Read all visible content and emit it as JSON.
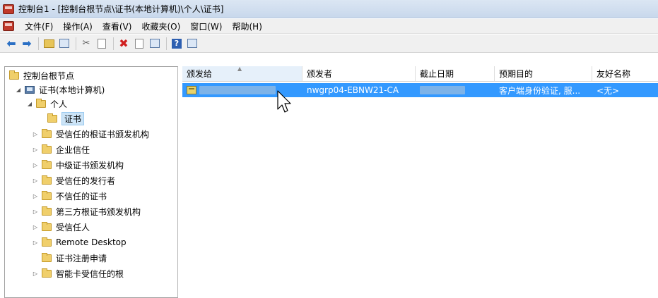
{
  "window": {
    "title": "控制台1 - [控制台根节点\\证书(本地计算机)\\个人\\证书]"
  },
  "menu": [
    "文件(F)",
    "操作(A)",
    "查看(V)",
    "收藏夹(O)",
    "窗口(W)",
    "帮助(H)"
  ],
  "toolbar": {
    "icons": [
      "back-icon",
      "forward-icon",
      "up-folder-icon",
      "show-tree-icon",
      "cut-icon",
      "copy-icon",
      "delete-icon",
      "properties-icon",
      "export-icon",
      "help-icon",
      "console-icon"
    ]
  },
  "tree": {
    "root": "控制台根节点",
    "computer": "证书(本地计算机)",
    "personal": "个人",
    "certs": "证书",
    "stores": [
      "受信任的根证书颁发机构",
      "企业信任",
      "中级证书颁发机构",
      "受信任的发行者",
      "不信任的证书",
      "第三方根证书颁发机构",
      "受信任人",
      "Remote Desktop",
      "证书注册申请",
      "智能卡受信任的根"
    ]
  },
  "list": {
    "columns": [
      "颁发给",
      "颁发者",
      "截止日期",
      "预期目的",
      "友好名称"
    ],
    "rows": [
      {
        "issued_to": "",
        "issued_by": "nwgrp04-EBNW21-CA",
        "expiration": "",
        "purposes": "客户端身份验证, 服...",
        "friendly_name": "<无>"
      }
    ]
  },
  "colors": {
    "selection": "#3399ff",
    "title_bar": "#c8d8ec"
  }
}
